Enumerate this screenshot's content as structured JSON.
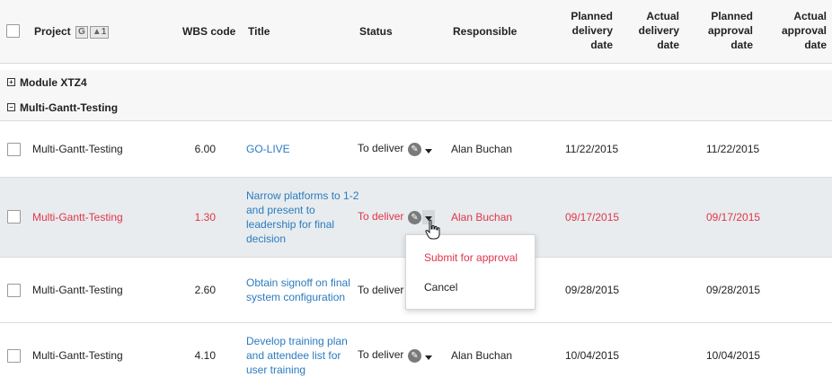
{
  "columns": {
    "project": "Project",
    "group_tag": "G",
    "sort_tag": "▲1",
    "wbs": "WBS code",
    "title": "Title",
    "status": "Status",
    "responsible": "Responsible",
    "planned_delivery": [
      "Planned",
      "delivery",
      "date"
    ],
    "actual_delivery": [
      "Actual",
      "delivery",
      "date"
    ],
    "planned_approval": [
      "Planned",
      "approval",
      "date"
    ],
    "actual_approval": [
      "Actual",
      "approval",
      "date"
    ]
  },
  "groups": [
    {
      "label": "Module XTZ4",
      "expander": "+"
    },
    {
      "label": "Multi-Gantt-Testing",
      "expander": "−"
    }
  ],
  "rows": [
    {
      "project": "Multi-Gantt-Testing",
      "wbs": "6.00",
      "title": [
        "GO-LIVE"
      ],
      "status": "To deliver",
      "responsible": "Alan Buchan",
      "planned_delivery": "11/22/2015",
      "planned_approval": "11/22/2015"
    },
    {
      "project": "Multi-Gantt-Testing",
      "wbs": "1.30",
      "title": [
        "Narrow platforms to 1-2",
        "and present to",
        "leadership for final",
        "decision"
      ],
      "status": "To deliver",
      "responsible": "Alan Buchan",
      "planned_delivery": "09/17/2015",
      "planned_approval": "09/17/2015"
    },
    {
      "project": "Multi-Gantt-Testing",
      "wbs": "2.60",
      "title": [
        "Obtain signoff on final",
        "system configuration"
      ],
      "status": "To deliver",
      "responsible": "",
      "planned_delivery": "09/28/2015",
      "planned_approval": "09/28/2015"
    },
    {
      "project": "Multi-Gantt-Testing",
      "wbs": "4.10",
      "title": [
        "Develop training plan",
        "and attendee list for",
        "user training"
      ],
      "status": "To deliver",
      "responsible": "Alan Buchan",
      "planned_delivery": "10/04/2015",
      "planned_approval": "10/04/2015"
    }
  ],
  "status_menu": {
    "items": [
      "Submit for approval",
      "Cancel"
    ]
  },
  "colors": {
    "link": "#2b7bbf",
    "highlight_text": "#e0354b",
    "selected_row_bg": "#e8ecee"
  },
  "icons": {
    "edit": "pencil-icon",
    "dropdown": "caret-down-icon",
    "cursor": "hand-pointer-icon"
  }
}
